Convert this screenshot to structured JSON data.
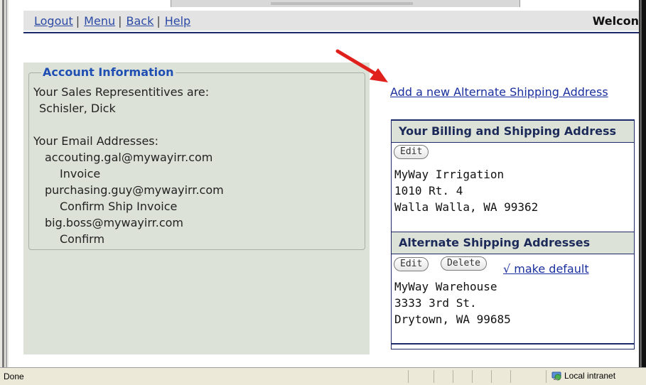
{
  "nav": {
    "logout": "Logout",
    "menu": "Menu",
    "back": "Back",
    "help": "Help",
    "separator": "|",
    "welcome": "Welcon"
  },
  "account": {
    "legend": "Account Information",
    "reps_label": "Your Sales Representitives are:",
    "reps": [
      "Schisler, Dick"
    ],
    "emails_label": "Your Email Addresses:",
    "emails": [
      {
        "address": "accouting.gal@mywayirr.com",
        "roles": "Invoice"
      },
      {
        "address": "purchasing.guy@mywayirr.com",
        "roles": "Confirm Ship Invoice"
      },
      {
        "address": "big.boss@mywayirr.com",
        "roles": "Confirm"
      }
    ]
  },
  "add_alt_link": "Add a new Alternate Shipping Address",
  "billing": {
    "header": "Your Billing and Shipping Address",
    "edit_label": "Edit",
    "lines": [
      "MyWay Irrigation",
      "1010 Rt. 4",
      "Walla Walla, WA 99362"
    ]
  },
  "alternate": {
    "header": "Alternate Shipping Addresses",
    "edit_label": "Edit",
    "delete_label": "Delete",
    "make_default": "√ make default",
    "lines": [
      "MyWay Warehouse",
      "3333 3rd St.",
      "Drytown, WA 99685"
    ]
  },
  "status": {
    "text": "Done",
    "zone": "Local intranet"
  },
  "colors": {
    "link": "#1a2f9e",
    "nav_rule": "#1c2a6a",
    "panel_bg": "#dde2d8",
    "legend": "#1f4fb3",
    "arrow": "#e0201c"
  }
}
